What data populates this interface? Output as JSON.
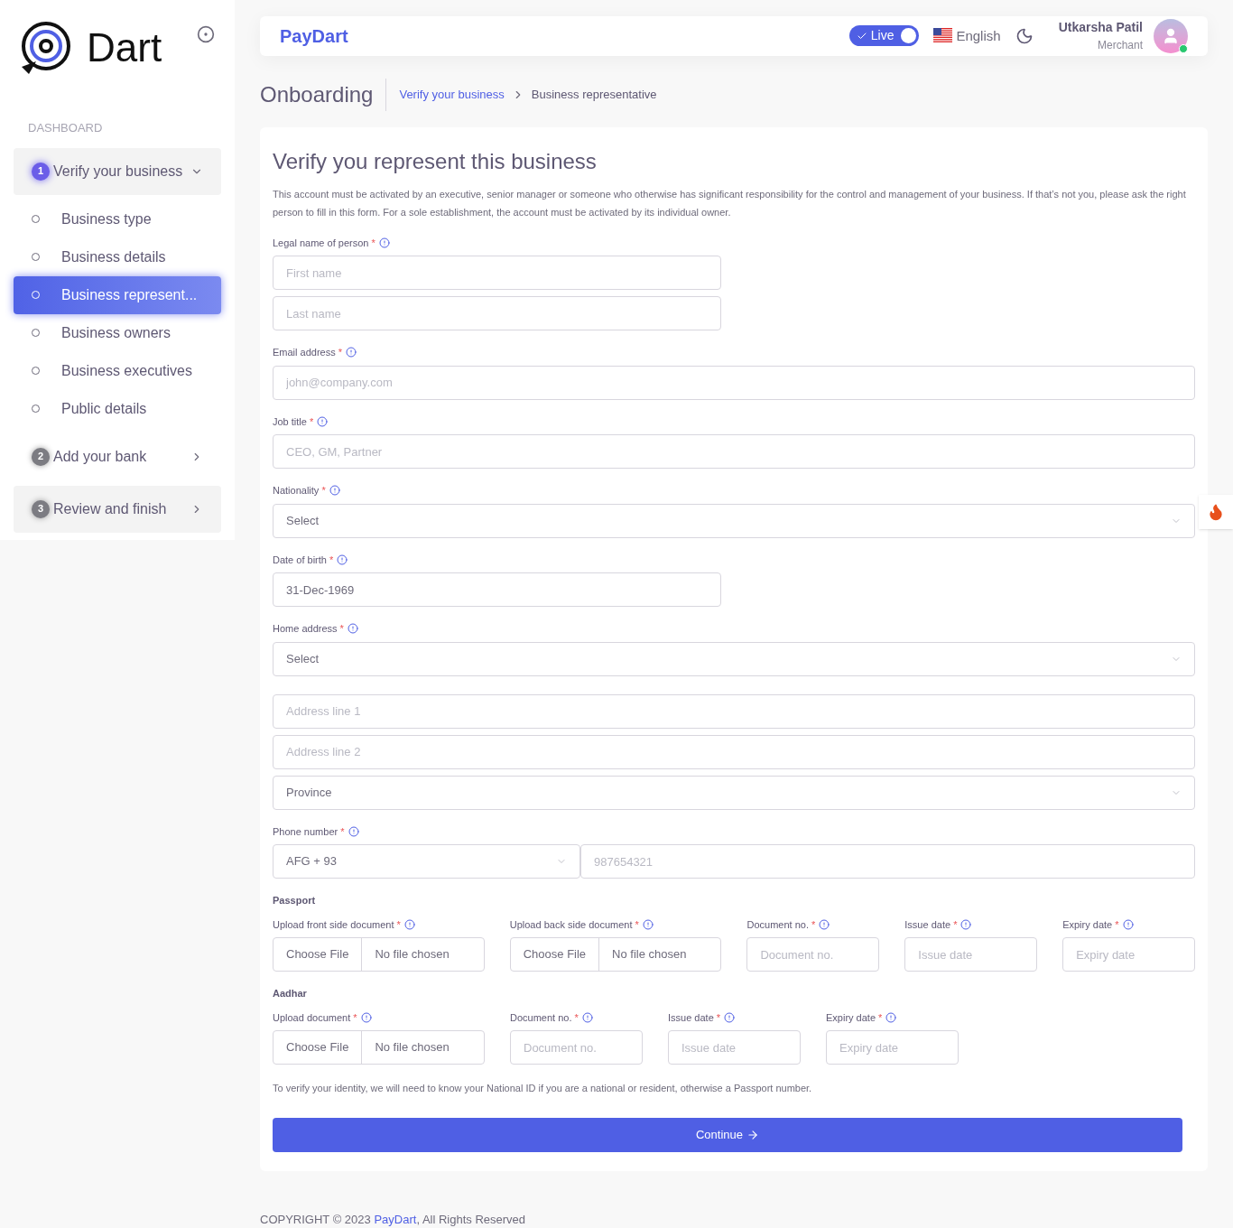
{
  "sidebar": {
    "logo_text": "Dart",
    "section_label": "DASHBOARD",
    "steps": [
      {
        "number": "1",
        "label": "Verify your business",
        "active": true,
        "expanded": true,
        "shaded": true,
        "children": [
          {
            "label": "Business type",
            "selected": false
          },
          {
            "label": "Business details",
            "selected": false
          },
          {
            "label": "Business represent...",
            "selected": true
          },
          {
            "label": "Business owners",
            "selected": false
          },
          {
            "label": "Business executives",
            "selected": false
          },
          {
            "label": "Public details",
            "selected": false
          }
        ]
      },
      {
        "number": "2",
        "label": "Add your bank",
        "active": false,
        "expanded": false,
        "shaded": false
      },
      {
        "number": "3",
        "label": "Review and finish",
        "active": false,
        "expanded": false,
        "shaded": true
      }
    ]
  },
  "header": {
    "brand": "PayDart",
    "live_toggle": {
      "label": "Live",
      "on": true
    },
    "language": "English",
    "user": {
      "name": "Utkarsha Patil",
      "role": "Merchant",
      "online": true
    }
  },
  "breadcrumb": {
    "title": "Onboarding",
    "items": [
      {
        "label": "Verify your business",
        "link": true
      },
      {
        "label": "Business representative",
        "link": false
      }
    ]
  },
  "form": {
    "title": "Verify you represent this business",
    "intro": "This account must be activated by an executive, senior manager or someone who otherwise has significant responsibility for the control and management of your business. If that’s not you, please ask the right person to fill in this form. For a sole establishment, the account must be activated by its individual owner.",
    "legal_name": {
      "label": "Legal name of person",
      "mark": "*",
      "inputs": [
        {
          "placeholder": "First name"
        },
        {
          "placeholder": "Last name"
        }
      ]
    },
    "email": {
      "label": "Email address",
      "mark": "*",
      "placeholder": "john@company.com"
    },
    "job_title": {
      "label": "Job title",
      "mark": "*",
      "placeholder": "CEO, GM, Partner"
    },
    "nationality": {
      "label": "Nationality",
      "mark": "*",
      "value": "Select"
    },
    "date_of_birth": {
      "label": "Date of birth",
      "mark": "*",
      "value": "31-Dec-1969"
    },
    "home_address": {
      "label": "Home address",
      "mark": "*",
      "country": "Select",
      "lines": [
        {
          "placeholder": "Address line 1"
        },
        {
          "placeholder": "Address line 2"
        }
      ],
      "province": "Province"
    },
    "phone": {
      "label": "Phone number",
      "mark": "*",
      "country_code": "AFG + 93",
      "placeholder": "987654321"
    },
    "documents": [
      {
        "title": "Passport",
        "fields": [
          {
            "kind": "file",
            "label": "Upload front side document",
            "mark": "*",
            "button": "Choose File",
            "status": "No file chosen"
          },
          {
            "kind": "file",
            "label": "Upload back side document",
            "mark": "*",
            "button": "Choose File",
            "status": "No file chosen"
          },
          {
            "kind": "text",
            "label": "Document no.",
            "mark": "*",
            "placeholder": "Document no."
          },
          {
            "kind": "text",
            "label": "Issue date",
            "mark": "*",
            "placeholder": "Issue date"
          },
          {
            "kind": "text",
            "label": "Expiry date",
            "mark": "*",
            "placeholder": "Expiry date"
          }
        ]
      },
      {
        "title": "Aadhar",
        "fields": [
          {
            "kind": "file",
            "label": "Upload document",
            "mark": "*",
            "button": "Choose File",
            "status": "No file chosen"
          },
          {
            "kind": "text",
            "label": "Document no.",
            "mark": "*",
            "placeholder": "Document no."
          },
          {
            "kind": "text",
            "label": "Issue date",
            "mark": "*",
            "placeholder": "Issue date"
          },
          {
            "kind": "text",
            "label": "Expiry date",
            "mark": "*",
            "placeholder": "Expiry date"
          }
        ]
      }
    ],
    "note": "To verify your identity, we will need to know your National ID if you are a national or resident, otherwise a Passport number.",
    "continue_button": "Continue"
  },
  "footer": {
    "prefix": "COPYRIGHT © 2023",
    "link": "PayDart",
    "suffix": ", All Rights Reserved"
  }
}
